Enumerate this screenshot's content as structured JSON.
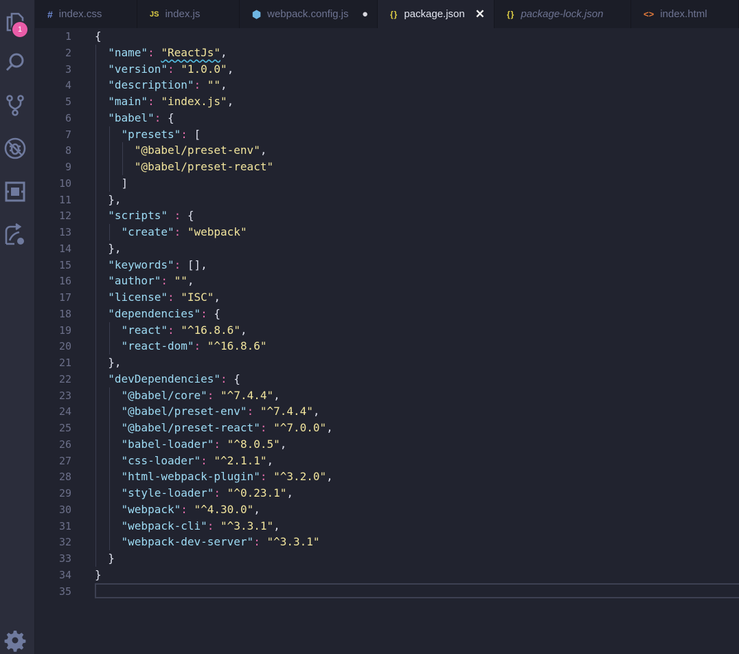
{
  "activity_bar": {
    "icons": [
      "explorer-icon",
      "search-icon",
      "source-control-icon",
      "debug-icon",
      "extensions-icon",
      "remote-explorer-icon",
      "settings-gear-icon"
    ],
    "explorer_badge": "1"
  },
  "tabs": [
    {
      "label": "index.css",
      "icon": "#",
      "state": "normal"
    },
    {
      "label": "index.js",
      "icon": "JS",
      "state": "normal"
    },
    {
      "label": "webpack.config.js",
      "icon": "⬢",
      "state": "modified"
    },
    {
      "label": "package.json",
      "icon": "{}",
      "state": "active"
    },
    {
      "label": "package-lock.json",
      "icon": "{}",
      "state": "preview"
    },
    {
      "label": "index.html",
      "icon": "<>",
      "state": "normal"
    }
  ],
  "tab_controls": {
    "close": "✕",
    "dirty": "●"
  },
  "editor": {
    "lines": [
      "{",
      "  \"name\": \"ReactJs\",",
      "  \"version\": \"1.0.0\",",
      "  \"description\": \"\",",
      "  \"main\": \"index.js\",",
      "  \"babel\": {",
      "    \"presets\": [",
      "      \"@babel/preset-env\",",
      "      \"@babel/preset-react\"",
      "    ]",
      "  },",
      "  \"scripts\" : {",
      "    \"create\": \"webpack\"",
      "  },",
      "  \"keywords\": [],",
      "  \"author\": \"\",",
      "  \"license\": \"ISC\",",
      "  \"dependencies\": {",
      "    \"react\": \"^16.8.6\",",
      "    \"react-dom\": \"^16.8.6\"",
      "  },",
      "  \"devDependencies\": {",
      "    \"@babel/core\": \"^7.4.4\",",
      "    \"@babel/preset-env\": \"^7.4.4\",",
      "    \"@babel/preset-react\": \"^7.0.0\",",
      "    \"babel-loader\": \"^8.0.5\",",
      "    \"css-loader\": \"^2.1.1\",",
      "    \"html-webpack-plugin\": \"^3.2.0\",",
      "    \"style-loader\": \"^0.23.1\",",
      "    \"webpack\": \"^4.30.0\",",
      "    \"webpack-cli\": \"^3.3.1\",",
      "    \"webpack-dev-server\": \"^3.3.1\"",
      "  }",
      "}",
      ""
    ],
    "warning_text": "\"ReactJs\"",
    "cursor_line": 35
  },
  "colors": {
    "string": "#f2e59d",
    "key": "#9edcf5",
    "punctuation": "#dfe2ee",
    "colon": "#e86fae",
    "badge": "#ea5ca8",
    "background": "#21232f"
  }
}
